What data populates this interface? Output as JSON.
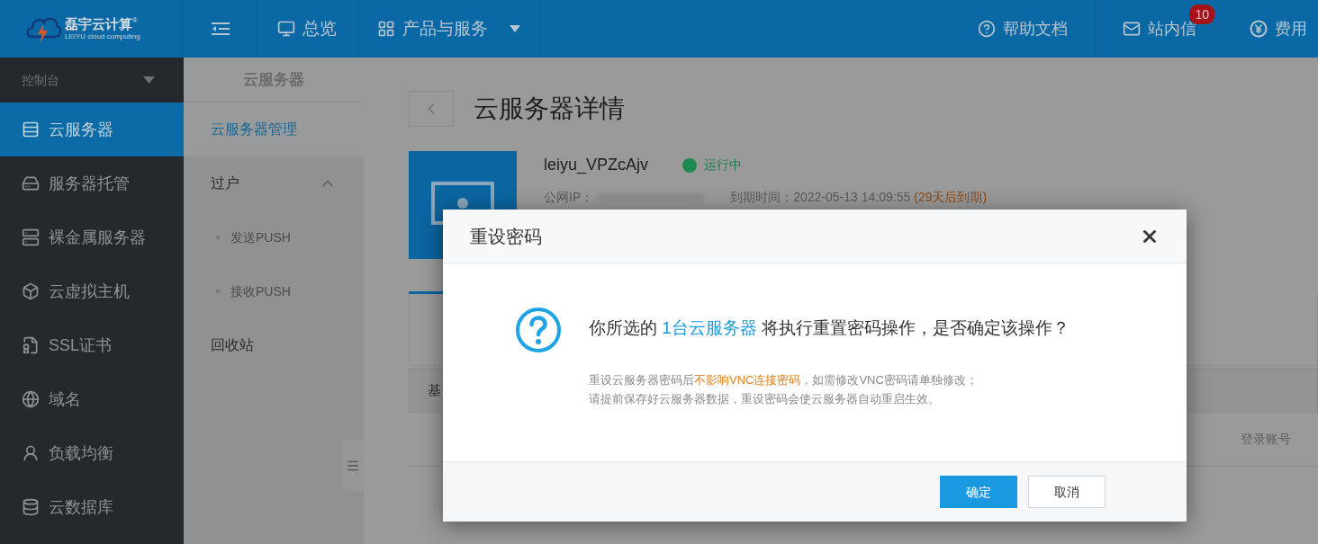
{
  "header": {
    "logo": {
      "name": "磊宇云计算",
      "mark": "®",
      "subtitle": "LEIYU cloud computing"
    },
    "nav": [
      {
        "label": "总览"
      },
      {
        "label": "产品与服务",
        "dropdown": true
      }
    ],
    "right": [
      {
        "label": "帮助文档"
      },
      {
        "label": "站内信",
        "badge": "10"
      },
      {
        "label": "费用"
      }
    ]
  },
  "sidebar": {
    "title": "控制台",
    "items": [
      {
        "label": "云服务器",
        "selected": true
      },
      {
        "label": "服务器托管",
        "selected": false
      },
      {
        "label": "裸金属服务器",
        "selected": false
      },
      {
        "label": "云虚拟主机",
        "selected": false
      },
      {
        "label": "SSL证书",
        "selected": false
      },
      {
        "label": "域名",
        "selected": false
      },
      {
        "label": "负载均衡",
        "selected": false
      },
      {
        "label": "云数据库",
        "selected": false
      }
    ]
  },
  "subnav": {
    "title": "云服务器",
    "items": [
      {
        "label": "云服务器管理",
        "selected": true
      },
      {
        "label": "过户",
        "selected": false,
        "expanded": true,
        "children": [
          {
            "label": "发送PUSH",
            "selected": false
          },
          {
            "label": "接收PUSH",
            "selected": false
          }
        ]
      },
      {
        "label": "回收站",
        "selected": false
      }
    ]
  },
  "main": {
    "title": "云服务器详情",
    "server": {
      "name": "leiyu_VPZcAjv",
      "status": "运行中",
      "ip_label": "公网IP：",
      "expiry_label": "到期时间：",
      "expiry": "2022-05-13 14:09:55",
      "remaining": "(29天后到期)"
    },
    "tab_partial": "基",
    "column": "登录账号"
  },
  "dialog": {
    "title": "重设密码",
    "message": [
      {
        "kind": "text",
        "text": "你所选的 "
      },
      {
        "kind": "link",
        "text": "1台云服务器"
      },
      {
        "kind": "text",
        "text": " 将执行重置密码操作，是否确定该操作？"
      }
    ],
    "notes": [
      [
        {
          "kind": "text",
          "text": "重设云服务器密码后"
        },
        {
          "kind": "warning",
          "text": "不影响VNC连接密码"
        },
        {
          "kind": "text",
          "text": "，如需修改VNC密码请单独修改；"
        }
      ],
      [
        {
          "kind": "text",
          "text": "请提前保存好云服务器数据，重设密码会使云服务器自动重启生效。"
        }
      ]
    ],
    "buttons": [
      {
        "label": "确定",
        "kind": "primary"
      },
      {
        "label": "取消",
        "kind": "default"
      }
    ]
  }
}
